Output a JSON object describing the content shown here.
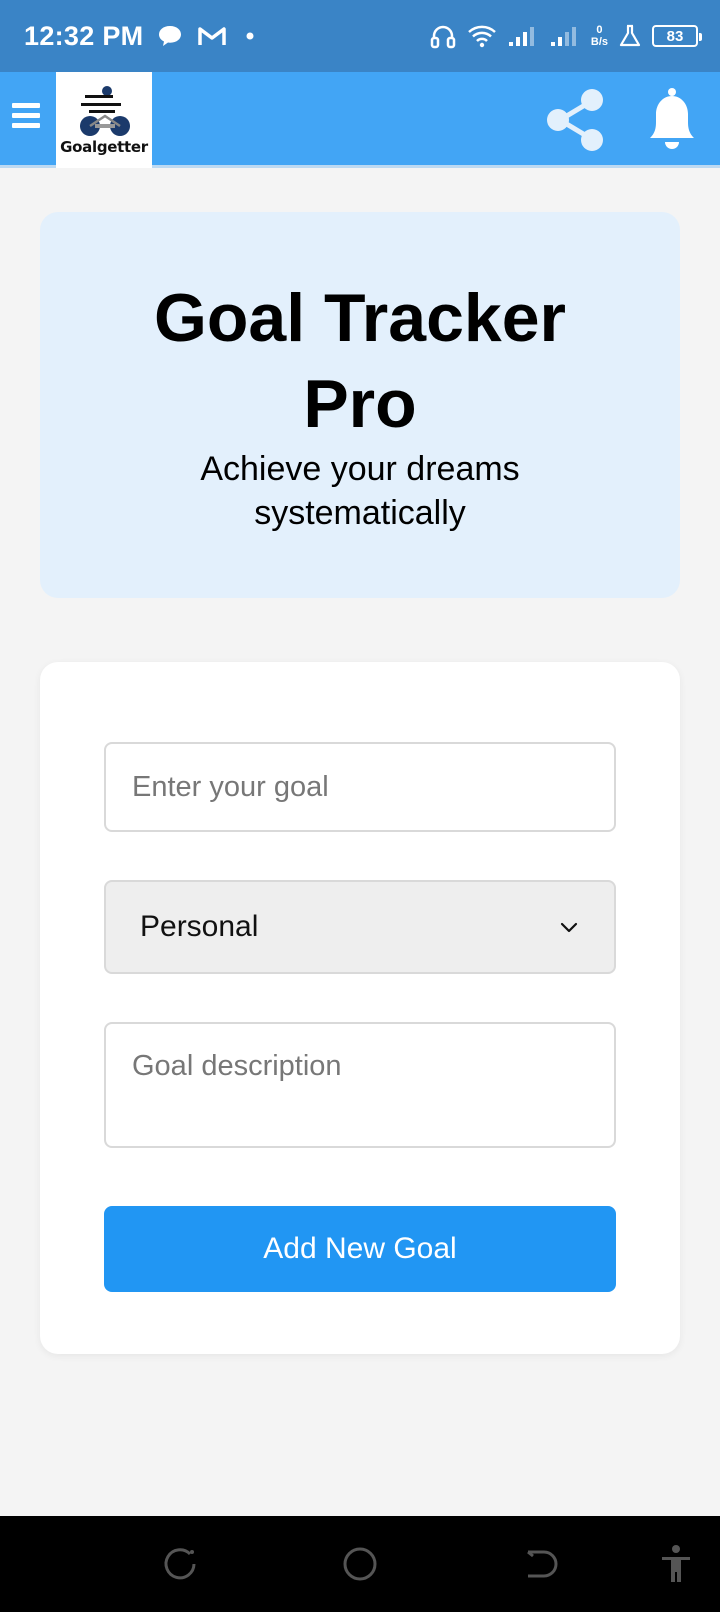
{
  "status_bar": {
    "time": "12:32 PM",
    "net_speed_value": "0",
    "net_speed_unit": "B/s",
    "battery": "83",
    "icons": [
      "chat-icon",
      "gmail-icon",
      "dot-icon",
      "headset-icon",
      "wifi-icon",
      "signal-icon",
      "signal-icon",
      "lab-icon",
      "battery-icon"
    ]
  },
  "header": {
    "logo_text": "Goalgetter",
    "icons": [
      "menu-icon",
      "share-icon",
      "bell-icon"
    ],
    "color": "#42a5f5"
  },
  "hero": {
    "title": "Goal Tracker Pro",
    "subtitle": "Achieve your dreams systematically",
    "background": "#e3f0fc"
  },
  "form": {
    "goal_placeholder": "Enter your goal",
    "category_selected": "Personal",
    "description_placeholder": "Goal description",
    "add_button_label": "Add New Goal",
    "button_color": "#2196f3"
  },
  "nav_bar": {
    "icons": [
      "recent-apps-icon",
      "home-icon",
      "back-icon",
      "accessibility-icon"
    ]
  }
}
